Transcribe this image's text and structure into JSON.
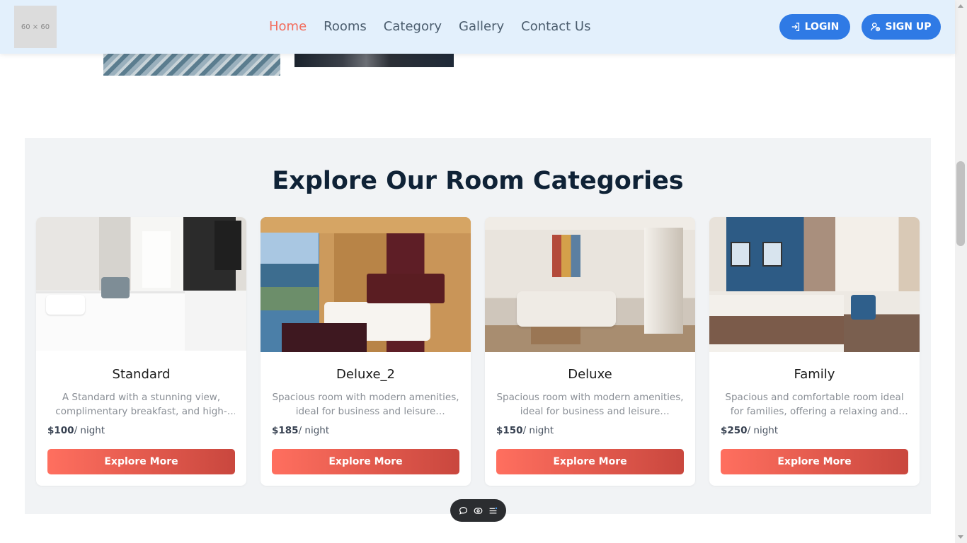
{
  "header": {
    "logo_text": "60 × 60",
    "nav": [
      {
        "label": "Home",
        "active": true
      },
      {
        "label": "Rooms",
        "active": false
      },
      {
        "label": "Category",
        "active": false
      },
      {
        "label": "Gallery",
        "active": false
      },
      {
        "label": "Contact Us",
        "active": false
      }
    ],
    "login_label": "LOGIN",
    "signup_label": "SIGN UP"
  },
  "categories_section": {
    "title": "Explore Our Room Categories",
    "cards": [
      {
        "name": "Standard",
        "description": "A Standard with a stunning view, complimentary breakfast, and high-speed internet.",
        "price": "$100",
        "price_unit": "/ night",
        "button_label": "Explore More"
      },
      {
        "name": "Deluxe_2",
        "description": "Spacious room with modern amenities, ideal for business and leisure travelers.",
        "price": "$185",
        "price_unit": "/ night",
        "button_label": "Explore More"
      },
      {
        "name": "Deluxe",
        "description": "Spacious room with modern amenities, ideal for business and leisure travelers.",
        "price": "$150",
        "price_unit": "/ night",
        "button_label": "Explore More"
      },
      {
        "name": "Family",
        "description": "Spacious and comfortable room ideal for families, offering a relaxing and enjoyable stay.",
        "price": "$250",
        "price_unit": "/ night",
        "button_label": "Explore More"
      }
    ]
  },
  "toolbar": {
    "icons": [
      "comment-icon",
      "eye-icon",
      "menu-list-icon"
    ]
  },
  "colors": {
    "header_bg": "#e3f0fc",
    "nav_active": "#f26b5b",
    "auth_button": "#2f7ae5",
    "card_button_start": "#ff6f5f",
    "card_button_end": "#c9473e",
    "section_bg": "#f1f3f5",
    "title": "#0f2236"
  }
}
